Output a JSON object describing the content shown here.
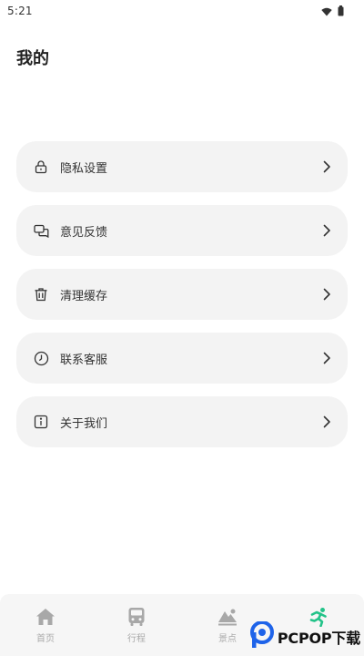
{
  "status_bar": {
    "time": "5:21",
    "icons": [
      "wifi-icon",
      "battery-icon"
    ]
  },
  "page": {
    "title": "我的"
  },
  "menu": {
    "items": [
      {
        "label": "隐私设置",
        "icon": "lock-icon"
      },
      {
        "label": "意见反馈",
        "icon": "chat-icon"
      },
      {
        "label": "清理缓存",
        "icon": "trash-icon"
      },
      {
        "label": "联系客服",
        "icon": "clock-icon"
      },
      {
        "label": "关于我们",
        "icon": "info-icon"
      }
    ]
  },
  "tabbar": {
    "tabs": [
      {
        "label": "首页",
        "icon": "home-icon"
      },
      {
        "label": "行程",
        "icon": "bus-icon"
      },
      {
        "label": "景点",
        "icon": "mountain-icon"
      },
      {
        "label": "",
        "icon": "runner-icon"
      }
    ]
  },
  "watermark": {
    "text": "PCPOP下载"
  },
  "colors": {
    "card_bg": "#f3f3f3",
    "tab_inactive": "#aaaaaa",
    "tab_active": "#23c389",
    "watermark_blue": "#1e63e9"
  }
}
